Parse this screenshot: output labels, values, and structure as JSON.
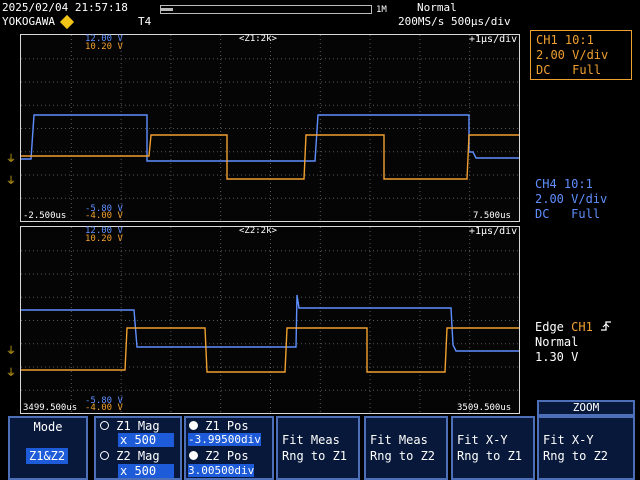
{
  "status": {
    "datetime": "2025/02/04 21:57:18",
    "brand": "YOKOGAWA",
    "mode": "Normal",
    "timebase": "200MS/s 500µs/div",
    "record": "1M",
    "trig_marker": "T4"
  },
  "channels": {
    "ch1": {
      "name": "CH1",
      "probe": "10:1",
      "vdiv": "2.00 V/div",
      "coupling": "DC",
      "bw": "Full"
    },
    "ch4": {
      "name": "CH4",
      "probe": "10:1",
      "vdiv": "2.00 V/div",
      "coupling": "DC",
      "bw": "Full"
    }
  },
  "trigger": {
    "type": "Edge",
    "source": "CH1",
    "mode": "Normal",
    "level": "1.30 V"
  },
  "zoom1": {
    "title": "<Z1:2k>",
    "scale": "+1µs/div",
    "ch4_top": "12.00 V",
    "ch1_top": "10.20 V",
    "ch4_bottom": "-5.80 V",
    "ch1_bottom": "-4.00 V",
    "t_left": "-2.500us",
    "t_right": "7.500us"
  },
  "zoom2": {
    "title": "<Z2:2k>",
    "scale": "+1µs/div",
    "ch4_top": "12.00 V",
    "ch1_top": "10.20 V",
    "ch4_bottom": "-5.80 V",
    "ch1_bottom": "-4.00 V",
    "t_left": "3499.500us",
    "t_right": "3509.500us"
  },
  "menu": {
    "mode": {
      "label": "Mode",
      "value": "Z1&Z2"
    },
    "mag": {
      "z1_label": "Z1 Mag",
      "z1_value": "x 500",
      "z2_label": "Z2 Mag",
      "z2_value": "x 500"
    },
    "pos": {
      "z1_label": "Z1 Pos",
      "z1_value": "-3.99500div",
      "z2_label": "Z2 Pos",
      "z2_value": "3.00500div"
    },
    "fit1": {
      "line1": "Fit Meas",
      "line2": "Rng to Z1"
    },
    "fit2": {
      "line1": "Fit Meas",
      "line2": "Rng to Z2"
    },
    "fitxy1": {
      "line1": "Fit X-Y",
      "line2": "Rng to Z1"
    },
    "fitxy2": {
      "line1": "Fit X-Y",
      "line2": "Rng to Z2"
    },
    "zoom_title": "ZOOM"
  },
  "colors": {
    "ch1": "#f0a030",
    "ch4": "#5f8fff",
    "grid": "#5a5a5a",
    "accent": "#f2c418",
    "menu_bg": "#08183a",
    "menu_hl": "#1d5bd8"
  }
}
